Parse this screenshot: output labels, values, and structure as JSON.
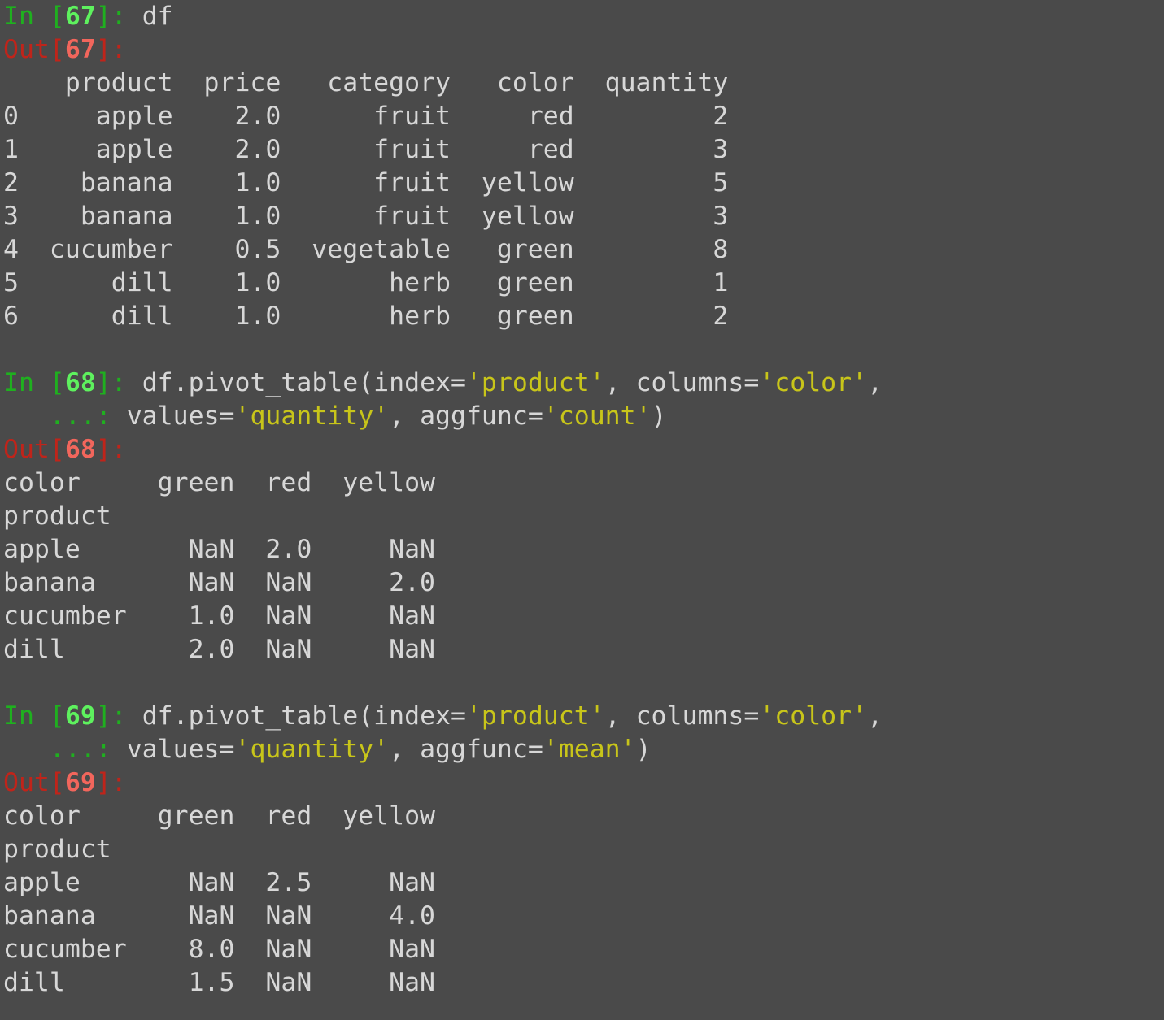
{
  "cells": [
    {
      "in_number": "67",
      "in_lines": [
        [
          {
            "t": "df",
            "k": "code"
          }
        ]
      ],
      "out_number": "67",
      "out_lines": [
        "    product  price   category   color  quantity",
        "0     apple    2.0      fruit     red         2",
        "1     apple    2.0      fruit     red         3",
        "2    banana    1.0      fruit  yellow         5",
        "3    banana    1.0      fruit  yellow         3",
        "4  cucumber    0.5  vegetable   green         8",
        "5      dill    1.0       herb   green         1",
        "6      dill    1.0       herb   green         2"
      ]
    },
    {
      "in_number": "68",
      "in_lines": [
        [
          {
            "t": "df.pivot_table(index=",
            "k": "code"
          },
          {
            "t": "'product'",
            "k": "str"
          },
          {
            "t": ", columns=",
            "k": "code"
          },
          {
            "t": "'color'",
            "k": "str"
          },
          {
            "t": ",",
            "k": "code"
          }
        ],
        [
          {
            "t": "values=",
            "k": "code"
          },
          {
            "t": "'quantity'",
            "k": "str"
          },
          {
            "t": ", aggfunc=",
            "k": "code"
          },
          {
            "t": "'count'",
            "k": "str"
          },
          {
            "t": ")",
            "k": "code"
          }
        ]
      ],
      "out_number": "68",
      "out_lines": [
        "color     green  red  yellow",
        "product",
        "apple       NaN  2.0     NaN",
        "banana      NaN  NaN     2.0",
        "cucumber    1.0  NaN     NaN",
        "dill        2.0  NaN     NaN"
      ]
    },
    {
      "in_number": "69",
      "in_lines": [
        [
          {
            "t": "df.pivot_table(index=",
            "k": "code"
          },
          {
            "t": "'product'",
            "k": "str"
          },
          {
            "t": ", columns=",
            "k": "code"
          },
          {
            "t": "'color'",
            "k": "str"
          },
          {
            "t": ",",
            "k": "code"
          }
        ],
        [
          {
            "t": "values=",
            "k": "code"
          },
          {
            "t": "'quantity'",
            "k": "str"
          },
          {
            "t": ", aggfunc=",
            "k": "code"
          },
          {
            "t": "'mean'",
            "k": "str"
          },
          {
            "t": ")",
            "k": "code"
          }
        ]
      ],
      "out_number": "69",
      "out_lines": [
        "color     green  red  yellow",
        "product",
        "apple       NaN  2.5     NaN",
        "banana      NaN  NaN     4.0",
        "cucumber    8.0  NaN     NaN",
        "dill        1.5  NaN     NaN"
      ]
    }
  ],
  "prompts": {
    "in_open": "In [",
    "in_close": "]: ",
    "out_open": "Out[",
    "out_close": "]:",
    "continuation": "   ...: "
  },
  "colors": {
    "background": "#4a4a4a",
    "text": "#d7d7d7",
    "in_prompt": "#1fb01f",
    "in_number": "#5ef15e",
    "out_prompt": "#c0241a",
    "out_number": "#f2665c",
    "string": "#c8c51a"
  }
}
